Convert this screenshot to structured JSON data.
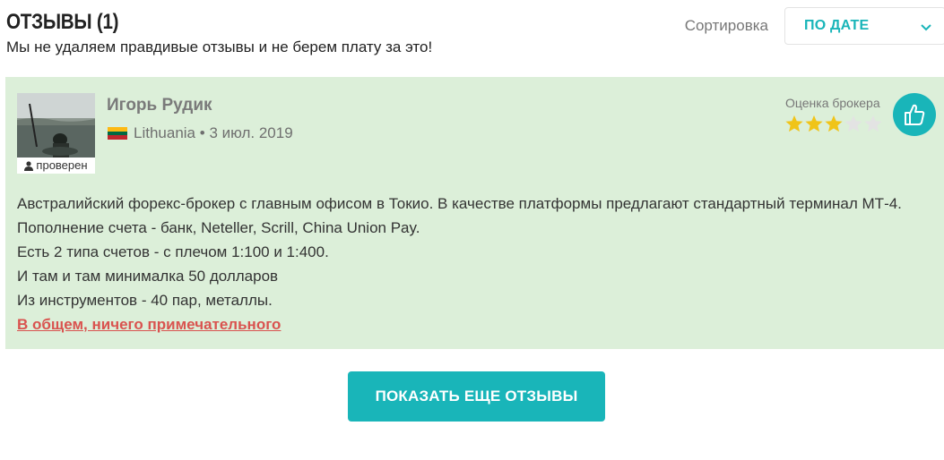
{
  "header": {
    "title": "ОТЗЫВЫ (1)",
    "subtitle": "Мы не удаляем правдивые отзывы и не берем плату за это!",
    "sort_label": "Сортировка",
    "sort_value": "ПО ДАТЕ"
  },
  "review": {
    "author": "Игорь Рудик",
    "verified_label": "проверен",
    "country": "Lithuania",
    "separator": "•",
    "date": "3 июл. 2019",
    "rating_label": "Оценка брокера",
    "rating": 3,
    "rating_max": 5,
    "lines": [
      "Австралийский форекс-брокер с главным офисом в Токио. В качестве платформы предлагают стандартный терминал МТ-4.",
      "Пополнение счета - банк, Neteller, Scrill, China Union Pay.",
      "Есть 2 типа счетов - с плечом 1:100 и 1:400.",
      "И там и там минималка 50 долларов",
      "Из инструментов - 40 пар, металлы."
    ],
    "conclusion": "В общем, ничего примечательного"
  },
  "footer": {
    "show_more_label": "ПОКАЗАТЬ ЕЩЕ ОТЗЫВЫ"
  },
  "colors": {
    "accent": "#19b5b9",
    "review_bg": "#dcefd9",
    "star_filled": "#f0c419",
    "star_empty": "#e3e3e3",
    "conclusion": "#d9534f"
  },
  "icons": {
    "sort": "chevron-down-icon",
    "like": "thumbs-up-icon",
    "verified": "user-icon",
    "flag": "lithuania-flag-icon"
  }
}
